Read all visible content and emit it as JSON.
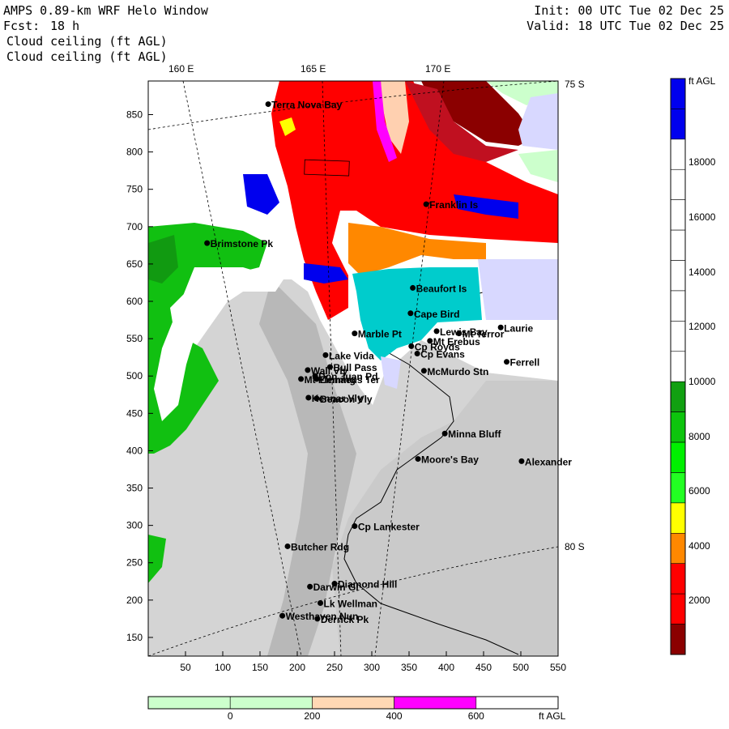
{
  "header": {
    "title": "AMPS 0.89-km WRF Helo Window",
    "forecast_label": "Fcst:",
    "forecast_hours": "18 h",
    "field_line1": "Cloud ceiling (ft AGL)",
    "field_line2": "Cloud ceiling (ft AGL)",
    "init": "Init: 00 UTC Tue 02 Dec 25",
    "valid": "Valid: 18 UTC Tue 02 Dec 25"
  },
  "map": {
    "lon_labels": [
      "160 E",
      "165 E",
      "170 E"
    ],
    "lat_labels": [
      "75 S",
      "80 S"
    ],
    "x_ticks": [
      "50",
      "100",
      "150",
      "200",
      "250",
      "300",
      "350",
      "400",
      "450",
      "500",
      "550"
    ],
    "y_ticks": [
      "850",
      "800",
      "750",
      "700",
      "650",
      "600",
      "550",
      "500",
      "450",
      "400",
      "350",
      "300",
      "250",
      "200",
      "150"
    ],
    "colors": {
      "terrain": "#d8d8d8",
      "ocean_clear": "#ffffff",
      "ice_shelf": "#cfcfcf"
    },
    "stations": [
      {
        "name": "Terra Nova Bay",
        "x": 161,
        "y": 864
      },
      {
        "name": "Franklin Is",
        "x": 373,
        "y": 730
      },
      {
        "name": "Brimstone Pk",
        "x": 79,
        "y": 678
      },
      {
        "name": "Beaufort Is",
        "x": 355,
        "y": 618
      },
      {
        "name": "Cape Bird",
        "x": 352,
        "y": 584
      },
      {
        "name": "Lewis Bay",
        "x": 387,
        "y": 560
      },
      {
        "name": "Laurie",
        "x": 473,
        "y": 565
      },
      {
        "name": "Marble Pt",
        "x": 277,
        "y": 557
      },
      {
        "name": "Mt Terror",
        "x": 417,
        "y": 557
      },
      {
        "name": "Cp Royds",
        "x": 353,
        "y": 540
      },
      {
        "name": "Mt Erebus",
        "x": 378,
        "y": 547
      },
      {
        "name": "Lake Vida",
        "x": 238,
        "y": 528
      },
      {
        "name": "Cp Evans",
        "x": 361,
        "y": 530
      },
      {
        "name": "Ferrell",
        "x": 481,
        "y": 519
      },
      {
        "name": "Wall Vly",
        "x": 214,
        "y": 508
      },
      {
        "name": "Bull Pass",
        "x": 244,
        "y": 512
      },
      {
        "name": "McMurdo Stn",
        "x": 370,
        "y": 507
      },
      {
        "name": "Don Juan Pd",
        "x": 224,
        "y": 500
      },
      {
        "name": "Mt Fleming",
        "x": 205,
        "y": 496
      },
      {
        "name": "Linnaeus Ter",
        "x": 226,
        "y": 496
      },
      {
        "name": "Kennar Vly",
        "x": 215,
        "y": 471
      },
      {
        "name": "Beacon Vly",
        "x": 226,
        "y": 470
      },
      {
        "name": "Minna Bluff",
        "x": 398,
        "y": 423
      },
      {
        "name": "Moore's Bay",
        "x": 362,
        "y": 389
      },
      {
        "name": "Alexander",
        "x": 501,
        "y": 386
      },
      {
        "name": "Cp Lankester",
        "x": 277,
        "y": 299
      },
      {
        "name": "Butcher Rdg",
        "x": 187,
        "y": 272
      },
      {
        "name": "Darwin Gl",
        "x": 217,
        "y": 218
      },
      {
        "name": "Diamond Hill",
        "x": 250,
        "y": 222
      },
      {
        "name": "Lk Wellman",
        "x": 231,
        "y": 196
      },
      {
        "name": "Westhaven Nun",
        "x": 180,
        "y": 179
      },
      {
        "name": "Derrick Pk",
        "x": 227,
        "y": 175
      }
    ]
  },
  "legend_right": {
    "unit": "ft AGL",
    "labels": [
      "18000",
      "16000",
      "14000",
      "12000",
      "10000",
      "8000",
      "6000",
      "4000",
      "2000"
    ],
    "colors": [
      "#0000ee",
      "#0000ee",
      "#ffffff",
      "#ffffff",
      "#ffffff",
      "#ffffff",
      "#ffffff",
      "#ffffff",
      "#ffffff",
      "#ffffff",
      "#11a011",
      "#0dc40d",
      "#00f000",
      "#22ff22",
      "#ffff00",
      "#ff8800",
      "#ff0000",
      "#ff0000",
      "#8b0000"
    ]
  },
  "legend_bottom": {
    "unit": "ft AGL",
    "labels": [
      "0",
      "200",
      "400",
      "600"
    ],
    "colors": [
      "#ccffcc",
      "#ccffcc",
      "#ffd8b4",
      "#ff00ff",
      "#ffffff"
    ]
  }
}
